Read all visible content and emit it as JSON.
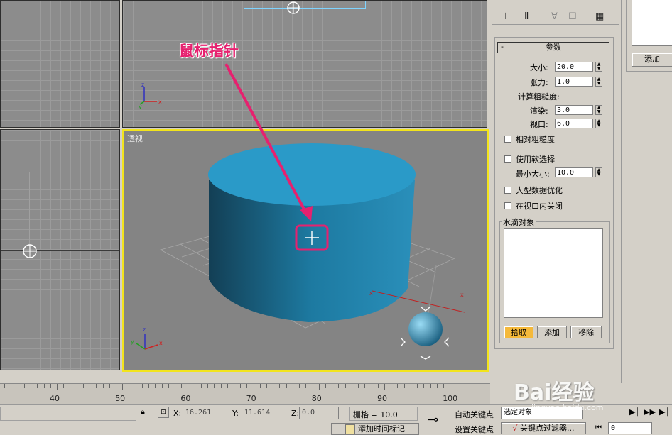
{
  "annotation": {
    "text": "鼠标指针"
  },
  "viewports": {
    "perspective_label": "透视"
  },
  "axes": {
    "x": "x",
    "y": "y",
    "z": "z"
  },
  "parameters": {
    "rollout_title": "参数",
    "collapse_symbol": "-",
    "size_label": "大小:",
    "size_value": "20.0",
    "tension_label": "张力:",
    "tension_value": "1.0",
    "roughness_title": "计算粗糙度:",
    "render_label": "渲染:",
    "render_value": "3.0",
    "viewport_label": "视口:",
    "viewport_value": "6.0",
    "relative_roughness": "相对粗糙度",
    "use_soft_selection": "使用软选择",
    "min_size_label": "最小大小:",
    "min_size_value": "10.0",
    "large_data_opt": "大型数据优化",
    "off_in_viewport": "在视口内关闭",
    "water_drop_title": "水滴对象",
    "pick_button": "拾取",
    "add_button": "添加",
    "remove_button": "移除"
  },
  "right_panel": {
    "add_button": "添加"
  },
  "ruler": {
    "labels": [
      "40",
      "50",
      "60",
      "70",
      "80",
      "90",
      "100"
    ]
  },
  "status_bar": {
    "x_label": "X:",
    "x_value": "16.261",
    "y_label": "Y:",
    "y_value": "11.614",
    "z_label": "Z:",
    "z_value": "0.0",
    "grid_label": "栅格 = 10.0",
    "auto_key": "自动关键点",
    "selected_dropdown": "选定对象",
    "set_key": "设置关键点",
    "key_filter": "关键点过滤器...",
    "add_time_tag": "添加时间标记",
    "frame_value": "0"
  },
  "watermark": {
    "brand": "Bai经验",
    "url": "jingyan.baidu.com"
  },
  "colors": {
    "cylinder": "#2a9ac8",
    "cylinder_side": "#1d6f93",
    "annotation": "#e6216f",
    "active_viewport": "#f2e41c",
    "pick_active": "#f5b93a"
  }
}
